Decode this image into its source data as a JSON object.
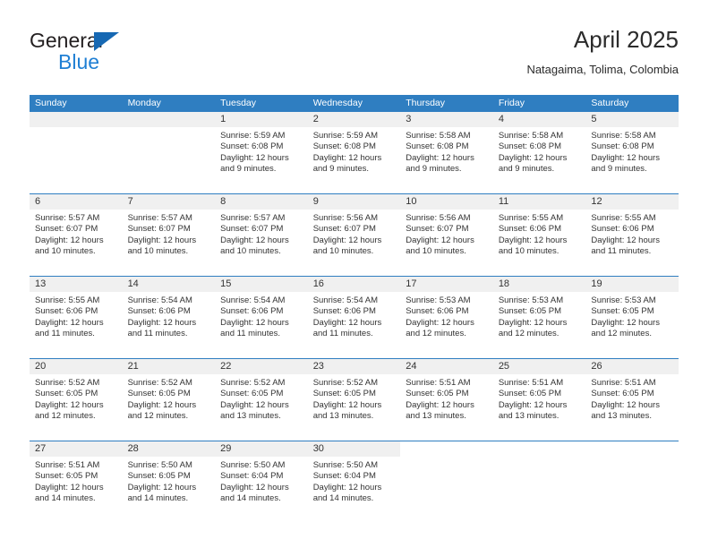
{
  "brand": {
    "name_dark": "General",
    "name_blue": "Blue",
    "triangle_color": "#1668b3",
    "blue_color": "#1f7fd4"
  },
  "header": {
    "title": "April 2025",
    "subtitle": "Natagaima, Tolima, Colombia",
    "accent_color": "#2f7ec1"
  },
  "weekdays": [
    "Sunday",
    "Monday",
    "Tuesday",
    "Wednesday",
    "Thursday",
    "Friday",
    "Saturday"
  ],
  "weeks": [
    [
      {
        "date": "",
        "empty": true
      },
      {
        "date": "",
        "empty": true
      },
      {
        "date": "1",
        "sunrise": "Sunrise: 5:59 AM",
        "sunset": "Sunset: 6:08 PM",
        "daylight1": "Daylight: 12 hours",
        "daylight2": "and 9 minutes."
      },
      {
        "date": "2",
        "sunrise": "Sunrise: 5:59 AM",
        "sunset": "Sunset: 6:08 PM",
        "daylight1": "Daylight: 12 hours",
        "daylight2": "and 9 minutes."
      },
      {
        "date": "3",
        "sunrise": "Sunrise: 5:58 AM",
        "sunset": "Sunset: 6:08 PM",
        "daylight1": "Daylight: 12 hours",
        "daylight2": "and 9 minutes."
      },
      {
        "date": "4",
        "sunrise": "Sunrise: 5:58 AM",
        "sunset": "Sunset: 6:08 PM",
        "daylight1": "Daylight: 12 hours",
        "daylight2": "and 9 minutes."
      },
      {
        "date": "5",
        "sunrise": "Sunrise: 5:58 AM",
        "sunset": "Sunset: 6:08 PM",
        "daylight1": "Daylight: 12 hours",
        "daylight2": "and 9 minutes."
      }
    ],
    [
      {
        "date": "6",
        "sunrise": "Sunrise: 5:57 AM",
        "sunset": "Sunset: 6:07 PM",
        "daylight1": "Daylight: 12 hours",
        "daylight2": "and 10 minutes."
      },
      {
        "date": "7",
        "sunrise": "Sunrise: 5:57 AM",
        "sunset": "Sunset: 6:07 PM",
        "daylight1": "Daylight: 12 hours",
        "daylight2": "and 10 minutes."
      },
      {
        "date": "8",
        "sunrise": "Sunrise: 5:57 AM",
        "sunset": "Sunset: 6:07 PM",
        "daylight1": "Daylight: 12 hours",
        "daylight2": "and 10 minutes."
      },
      {
        "date": "9",
        "sunrise": "Sunrise: 5:56 AM",
        "sunset": "Sunset: 6:07 PM",
        "daylight1": "Daylight: 12 hours",
        "daylight2": "and 10 minutes."
      },
      {
        "date": "10",
        "sunrise": "Sunrise: 5:56 AM",
        "sunset": "Sunset: 6:07 PM",
        "daylight1": "Daylight: 12 hours",
        "daylight2": "and 10 minutes."
      },
      {
        "date": "11",
        "sunrise": "Sunrise: 5:55 AM",
        "sunset": "Sunset: 6:06 PM",
        "daylight1": "Daylight: 12 hours",
        "daylight2": "and 10 minutes."
      },
      {
        "date": "12",
        "sunrise": "Sunrise: 5:55 AM",
        "sunset": "Sunset: 6:06 PM",
        "daylight1": "Daylight: 12 hours",
        "daylight2": "and 11 minutes."
      }
    ],
    [
      {
        "date": "13",
        "sunrise": "Sunrise: 5:55 AM",
        "sunset": "Sunset: 6:06 PM",
        "daylight1": "Daylight: 12 hours",
        "daylight2": "and 11 minutes."
      },
      {
        "date": "14",
        "sunrise": "Sunrise: 5:54 AM",
        "sunset": "Sunset: 6:06 PM",
        "daylight1": "Daylight: 12 hours",
        "daylight2": "and 11 minutes."
      },
      {
        "date": "15",
        "sunrise": "Sunrise: 5:54 AM",
        "sunset": "Sunset: 6:06 PM",
        "daylight1": "Daylight: 12 hours",
        "daylight2": "and 11 minutes."
      },
      {
        "date": "16",
        "sunrise": "Sunrise: 5:54 AM",
        "sunset": "Sunset: 6:06 PM",
        "daylight1": "Daylight: 12 hours",
        "daylight2": "and 11 minutes."
      },
      {
        "date": "17",
        "sunrise": "Sunrise: 5:53 AM",
        "sunset": "Sunset: 6:06 PM",
        "daylight1": "Daylight: 12 hours",
        "daylight2": "and 12 minutes."
      },
      {
        "date": "18",
        "sunrise": "Sunrise: 5:53 AM",
        "sunset": "Sunset: 6:05 PM",
        "daylight1": "Daylight: 12 hours",
        "daylight2": "and 12 minutes."
      },
      {
        "date": "19",
        "sunrise": "Sunrise: 5:53 AM",
        "sunset": "Sunset: 6:05 PM",
        "daylight1": "Daylight: 12 hours",
        "daylight2": "and 12 minutes."
      }
    ],
    [
      {
        "date": "20",
        "sunrise": "Sunrise: 5:52 AM",
        "sunset": "Sunset: 6:05 PM",
        "daylight1": "Daylight: 12 hours",
        "daylight2": "and 12 minutes."
      },
      {
        "date": "21",
        "sunrise": "Sunrise: 5:52 AM",
        "sunset": "Sunset: 6:05 PM",
        "daylight1": "Daylight: 12 hours",
        "daylight2": "and 12 minutes."
      },
      {
        "date": "22",
        "sunrise": "Sunrise: 5:52 AM",
        "sunset": "Sunset: 6:05 PM",
        "daylight1": "Daylight: 12 hours",
        "daylight2": "and 13 minutes."
      },
      {
        "date": "23",
        "sunrise": "Sunrise: 5:52 AM",
        "sunset": "Sunset: 6:05 PM",
        "daylight1": "Daylight: 12 hours",
        "daylight2": "and 13 minutes."
      },
      {
        "date": "24",
        "sunrise": "Sunrise: 5:51 AM",
        "sunset": "Sunset: 6:05 PM",
        "daylight1": "Daylight: 12 hours",
        "daylight2": "and 13 minutes."
      },
      {
        "date": "25",
        "sunrise": "Sunrise: 5:51 AM",
        "sunset": "Sunset: 6:05 PM",
        "daylight1": "Daylight: 12 hours",
        "daylight2": "and 13 minutes."
      },
      {
        "date": "26",
        "sunrise": "Sunrise: 5:51 AM",
        "sunset": "Sunset: 6:05 PM",
        "daylight1": "Daylight: 12 hours",
        "daylight2": "and 13 minutes."
      }
    ],
    [
      {
        "date": "27",
        "sunrise": "Sunrise: 5:51 AM",
        "sunset": "Sunset: 6:05 PM",
        "daylight1": "Daylight: 12 hours",
        "daylight2": "and 14 minutes."
      },
      {
        "date": "28",
        "sunrise": "Sunrise: 5:50 AM",
        "sunset": "Sunset: 6:05 PM",
        "daylight1": "Daylight: 12 hours",
        "daylight2": "and 14 minutes."
      },
      {
        "date": "29",
        "sunrise": "Sunrise: 5:50 AM",
        "sunset": "Sunset: 6:04 PM",
        "daylight1": "Daylight: 12 hours",
        "daylight2": "and 14 minutes."
      },
      {
        "date": "30",
        "sunrise": "Sunrise: 5:50 AM",
        "sunset": "Sunset: 6:04 PM",
        "daylight1": "Daylight: 12 hours",
        "daylight2": "and 14 minutes."
      },
      {
        "date": "",
        "nodata": true
      },
      {
        "date": "",
        "nodata": true
      },
      {
        "date": "",
        "nodata": true
      }
    ]
  ]
}
